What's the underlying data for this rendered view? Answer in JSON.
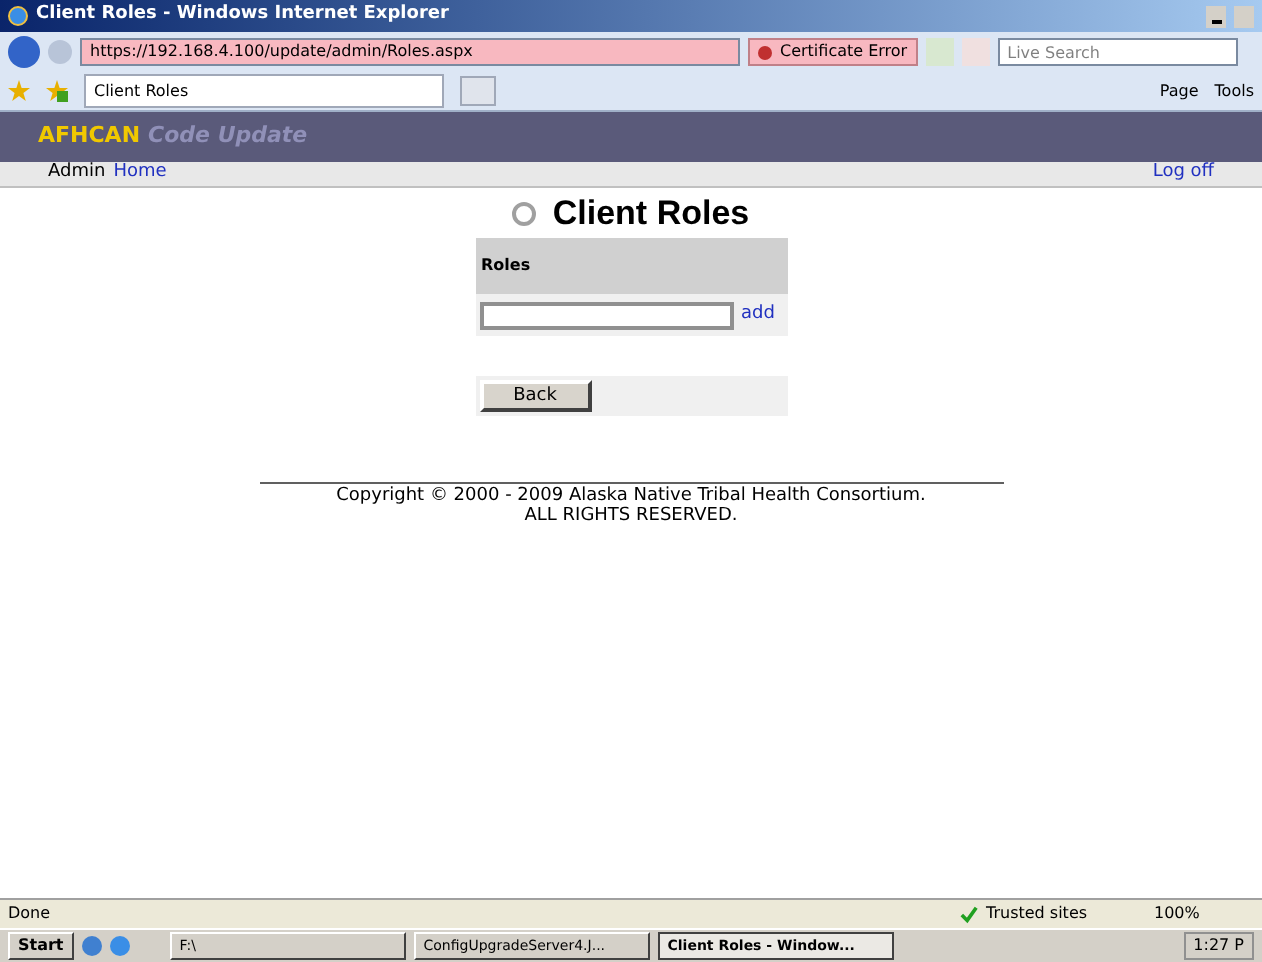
{
  "window": {
    "title": "Client Roles - Windows Internet Explorer"
  },
  "address_bar": {
    "url": "https://192.168.4.100/update/admin/Roles.aspx",
    "certificate": "Certificate Error",
    "search_placeholder": "Live Search"
  },
  "tabs": [
    {
      "label": "Client Roles",
      "selected": true
    }
  ],
  "command_bar": {
    "page": "Page",
    "tools": "Tools"
  },
  "site_header": {
    "brand": "AFHCAN",
    "subtitle": "Code Update"
  },
  "site_nav": {
    "admin": "Admin",
    "home": "Home",
    "logoff": "Log off"
  },
  "page": {
    "title": "Client Roles",
    "table_header": "Roles",
    "add": "add",
    "back": "Back"
  },
  "footer": {
    "copyright": "Copyright © 2000 - 2009 Alaska Native Tribal Health Consortium.",
    "rights": "ALL RIGHTS RESERVED."
  },
  "status_bar": {
    "status": "Done",
    "zone": "Trusted sites",
    "zoom": "100%"
  },
  "taskbar": {
    "start": "Start",
    "tasks": [
      {
        "label": "F:\\",
        "selected": false
      },
      {
        "label": "ConfigUpgradeServer4.J...",
        "selected": false
      },
      {
        "label": "Client Roles - Window...",
        "selected": true
      }
    ],
    "clock": "1:27 P"
  }
}
